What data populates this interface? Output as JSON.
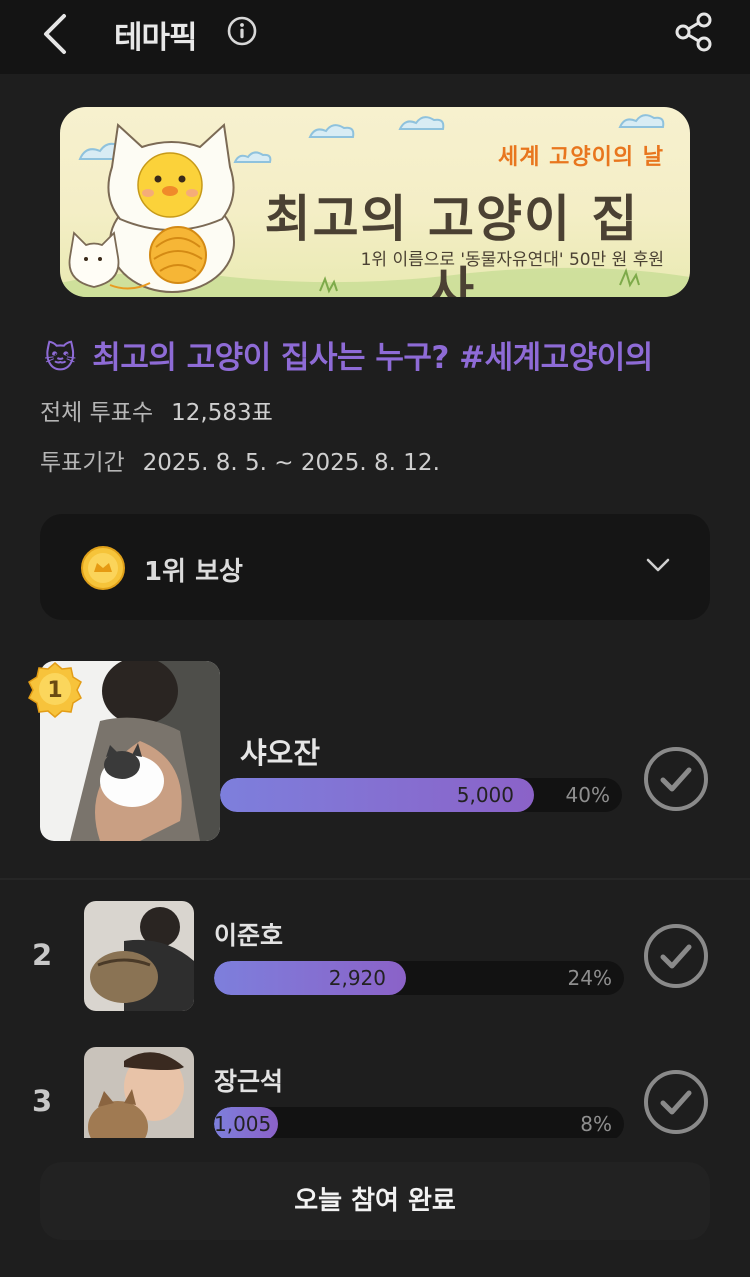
{
  "header": {
    "title": "테마픽"
  },
  "banner": {
    "subtitle": "세계 고양이의 날",
    "title": "최고의 고양이 집사",
    "note": "1위 이름으로 '동물자유연대' 50만 원 후원"
  },
  "poll": {
    "emoji": "🐱",
    "title": "최고의 고양이 집사는 누구? #세계고양이의",
    "total_label": "전체 투표수",
    "total_value": "12,583표",
    "period_label": "투표기간",
    "period_value": "2025. 8. 5. ~ 2025. 8. 12."
  },
  "reward": {
    "label": "1위 보상"
  },
  "candidates": [
    {
      "rank": "1",
      "name": "샤오잔",
      "votes": "5,000",
      "percent": "40%",
      "share": 0.4
    },
    {
      "rank": "2",
      "name": "이준호",
      "votes": "2,920",
      "percent": "24%",
      "share": 0.24
    },
    {
      "rank": "3",
      "name": "장근석",
      "votes": "1,005",
      "percent": "8%",
      "share": 0.08
    }
  ],
  "footer": {
    "button_label": "오늘 참여 완료"
  },
  "colors": {
    "accent": "#8e6bd6",
    "bar_start": "#7d7fdc",
    "bar_end": "#8b62c8"
  }
}
